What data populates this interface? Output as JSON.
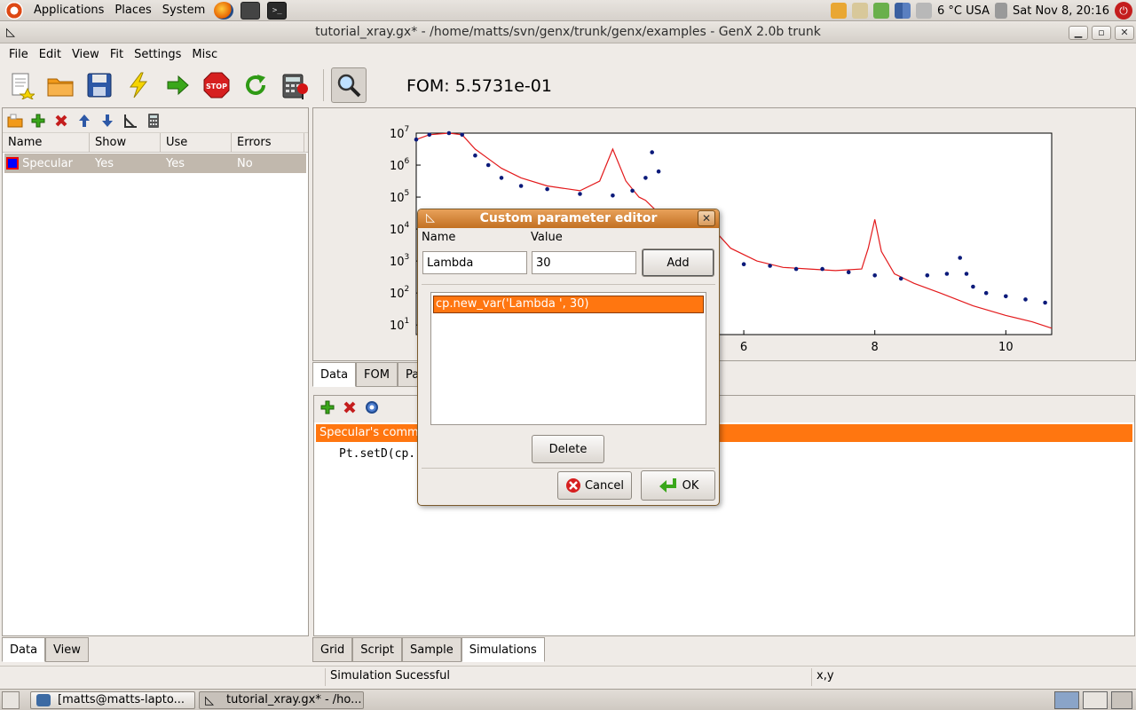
{
  "top_panel": {
    "menus": [
      "Applications",
      "Places",
      "System"
    ],
    "weather": "6 °C USA",
    "clock": "Sat Nov  8, 20:16"
  },
  "window": {
    "title": "tutorial_xray.gx* - /home/matts/svn/genx/trunk/genx/examples - GenX 2.0b trunk",
    "btn_minimize": "▁",
    "btn_maximize": "▫",
    "btn_close": "✕"
  },
  "menubar": [
    "File",
    "Edit",
    "View",
    "Fit",
    "Settings",
    "Misc"
  ],
  "toolbar": {
    "fom_label": "FOM: 5.5731e-01"
  },
  "data_list": {
    "columns": [
      "Name",
      "Show",
      "Use",
      "Errors"
    ],
    "rows": [
      {
        "name": "Specular",
        "show": "Yes",
        "use": "Yes",
        "errors": "No"
      }
    ]
  },
  "left_tabs": [
    "Data",
    "View"
  ],
  "plot_tabs": [
    "Data",
    "FOM",
    "Par"
  ],
  "bottom_tabs": [
    "Grid",
    "Script",
    "Sample",
    "Simulations"
  ],
  "script_panel": {
    "command_header": "Specular's comm",
    "command_line": "Pt.setD(cp."
  },
  "chart_data": {
    "type": "line",
    "x_ticks": [
      "6",
      "8",
      "10"
    ],
    "y_ticks": [
      {
        "base": "10",
        "exp": "7"
      },
      {
        "base": "10",
        "exp": "6"
      },
      {
        "base": "10",
        "exp": "5"
      },
      {
        "base": "10",
        "exp": "4"
      },
      {
        "base": "10",
        "exp": "3"
      },
      {
        "base": "10",
        "exp": "2"
      },
      {
        "base": "10",
        "exp": "1"
      }
    ],
    "xlim": [
      1,
      10.7
    ],
    "ylim_log10": [
      0.7,
      7
    ],
    "colors": {
      "simulation": "#e31a1c",
      "data": "#0b1a7a"
    },
    "series": [
      {
        "kind": "line",
        "x": [
          1.0,
          1.2,
          1.5,
          1.7,
          1.9,
          2.1,
          2.3,
          2.6,
          3.0,
          3.5,
          3.8,
          4.0,
          4.2,
          4.4,
          4.5,
          4.7,
          5.0,
          5.2,
          5.4,
          5.8,
          6.2,
          6.6,
          7.0,
          7.4,
          7.8,
          7.9,
          8.0,
          8.1,
          8.3,
          8.6,
          9.0,
          9.5,
          10.0,
          10.4,
          10.7
        ],
        "y_log10": [
          6.8,
          6.95,
          7.0,
          6.95,
          6.5,
          6.2,
          5.9,
          5.6,
          5.35,
          5.2,
          5.5,
          6.5,
          5.5,
          5.0,
          4.9,
          4.5,
          3.8,
          3.7,
          4.3,
          3.4,
          3.0,
          2.8,
          2.75,
          2.7,
          2.75,
          3.4,
          4.3,
          3.3,
          2.6,
          2.3,
          2.0,
          1.6,
          1.3,
          1.1,
          0.9
        ]
      },
      {
        "kind": "points",
        "x": [
          1.0,
          1.2,
          1.5,
          1.7,
          1.9,
          2.1,
          2.3,
          2.6,
          3.0,
          3.5,
          4.0,
          4.3,
          4.5,
          4.6,
          4.7,
          4.8,
          5.0,
          5.3,
          5.6,
          6.0,
          6.4,
          6.8,
          7.2,
          7.6,
          8.0,
          8.4,
          8.8,
          9.1,
          9.3,
          9.4,
          9.5,
          9.7,
          10.0,
          10.3,
          10.6
        ],
        "y_log10": [
          6.8,
          6.95,
          7.0,
          6.95,
          6.3,
          6.0,
          5.6,
          5.35,
          5.25,
          5.1,
          5.05,
          5.2,
          5.6,
          6.4,
          5.8,
          4.5,
          3.8,
          3.3,
          2.8,
          2.9,
          2.85,
          2.75,
          2.75,
          2.65,
          2.55,
          2.45,
          2.55,
          2.6,
          3.1,
          2.6,
          2.2,
          2.0,
          1.9,
          1.8,
          1.7
        ]
      }
    ]
  },
  "dialog": {
    "title": "Custom parameter editor",
    "name_label": "Name",
    "value_label": "Value",
    "name_value": "Lambda",
    "value_value": "30",
    "add_label": "Add",
    "list_items": [
      "cp.new_var('Lambda ', 30)"
    ],
    "delete_label": "Delete",
    "cancel_label": "Cancel",
    "ok_label": "OK"
  },
  "statusbar": {
    "message": "Simulation Sucessful",
    "coords": "x,y"
  },
  "taskbar": [
    "[matts@matts-lapto...",
    "tutorial_xray.gx* - /ho..."
  ]
}
